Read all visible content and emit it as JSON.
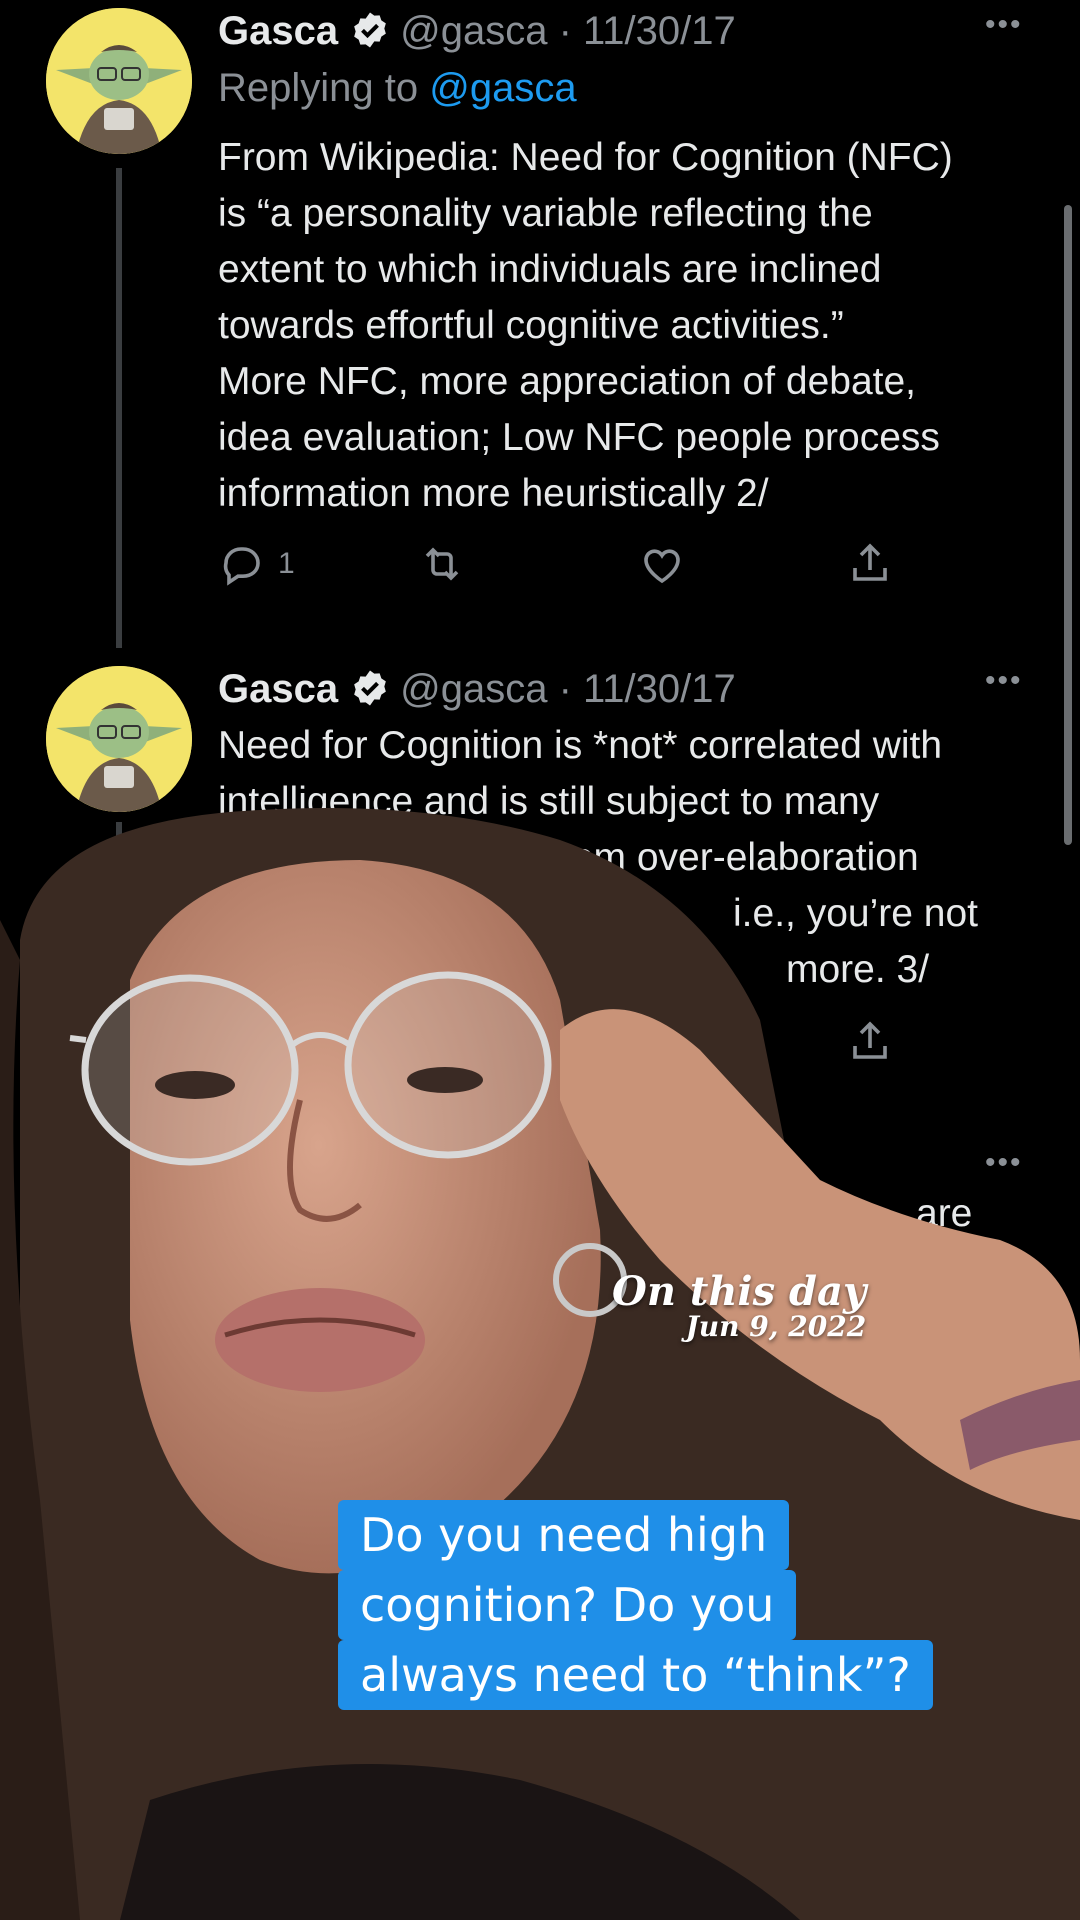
{
  "tweets": [
    {
      "name": "Gasca",
      "handle": "@gasca",
      "date": "11/30/17",
      "replying_prefix": "Replying to",
      "replying_to": "@gasca",
      "lines": [
        "From Wikipedia: Need for Cognition (NFC)",
        "is “a personality variable reflecting the",
        "extent to which individuals are inclined",
        "towards effortful cognitive activities.”",
        "More NFC, more appreciation of debate,",
        "idea evaluation; Low NFC people process",
        "information more heuristically 2/"
      ],
      "reply_count": "1"
    },
    {
      "name": "Gasca",
      "handle": "@gasca",
      "date": "11/30/17",
      "lines": [
        "Need for Cognition is *not* correlated with",
        "intelligence and is still subject to many",
        "from over-elaboration",
        "i.e., you’re not",
        "more. 3/"
      ]
    }
  ],
  "partial_third": {
    "fragment": "are"
  },
  "overlay": {
    "stamp_title": "On this day",
    "stamp_date": "Jun 9, 2022",
    "caption_lines": [
      "Do you need high",
      "cognition? Do you",
      "always need to “think”?"
    ]
  },
  "icons": [
    "verified-badge-icon",
    "more-icon",
    "reply-icon",
    "retweet-icon",
    "like-icon",
    "share-icon"
  ],
  "colors": {
    "background": "#000000",
    "link": "#1d9bf0",
    "muted": "#8b9096",
    "caption_bg": "#1f8fe8"
  }
}
